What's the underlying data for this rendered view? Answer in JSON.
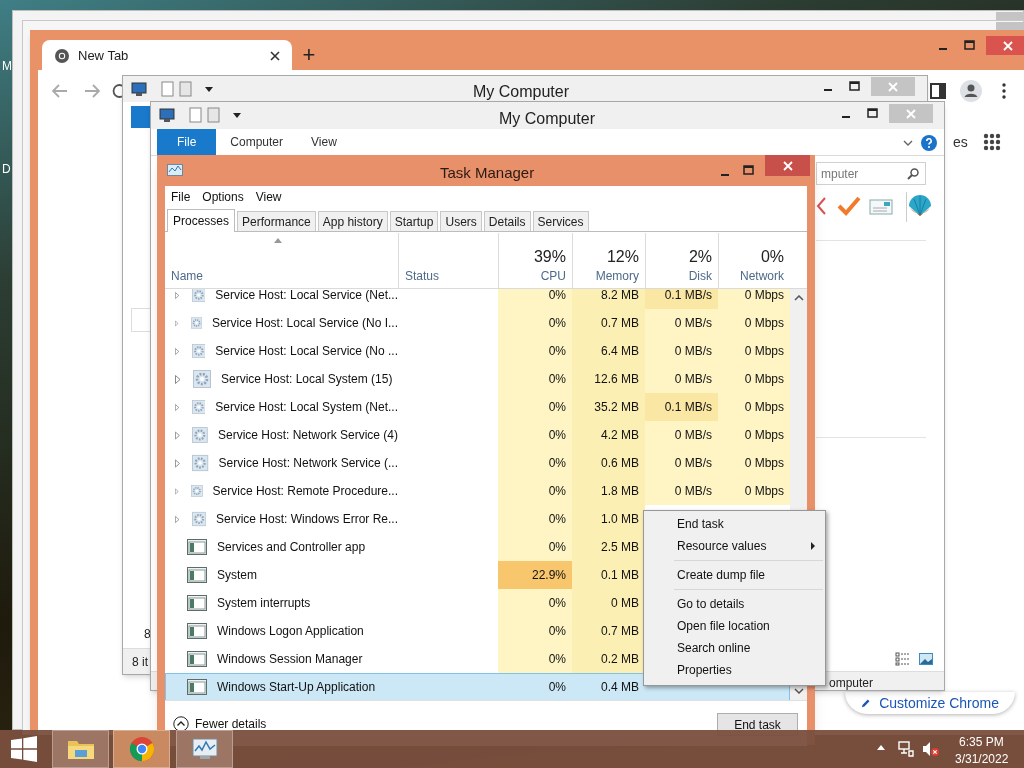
{
  "desktop_labels": [
    "M",
    "D"
  ],
  "browser": {
    "tab": {
      "title": "New Tab",
      "selected": true
    },
    "new_tab": "+",
    "partial_text": "es",
    "customize_button": "Customize Chrome"
  },
  "explorer_back": {
    "title": "My Computer",
    "row_partial": "8",
    "status_partial": "8 it"
  },
  "explorer_front": {
    "title": "My Computer",
    "ribbon_tabs": [
      {
        "label": "File",
        "selected": true
      },
      {
        "label": "Computer",
        "selected": false
      },
      {
        "label": "View",
        "selected": false
      }
    ],
    "search": {
      "placeholder": "mputer"
    },
    "status": "omputer"
  },
  "task_manager": {
    "title": "Task Manager",
    "menu": [
      "File",
      "Options",
      "View"
    ],
    "tabs": [
      {
        "label": "Processes",
        "selected": true
      },
      {
        "label": "Performance",
        "selected": false
      },
      {
        "label": "App history",
        "selected": false
      },
      {
        "label": "Startup",
        "selected": false
      },
      {
        "label": "Users",
        "selected": false
      },
      {
        "label": "Details",
        "selected": false
      },
      {
        "label": "Services",
        "selected": false
      }
    ],
    "columns": [
      {
        "label": "Name"
      },
      {
        "label": "Status"
      },
      {
        "label": "CPU",
        "total": "39%"
      },
      {
        "label": "Memory",
        "total": "12%"
      },
      {
        "label": "Disk",
        "total": "2%"
      },
      {
        "label": "Network",
        "total": "0%"
      }
    ],
    "rows": [
      {
        "kind": "service",
        "name": "Service Host: Local Service (Net...",
        "cpu": "0%",
        "memory": "8.2 MB",
        "disk": "0.1 MB/s",
        "network": "0 Mbps",
        "cpu_high": false,
        "disk_high": true,
        "selected": false
      },
      {
        "kind": "service",
        "name": "Service Host: Local Service (No I...",
        "cpu": "0%",
        "memory": "0.7 MB",
        "disk": "0 MB/s",
        "network": "0 Mbps",
        "cpu_high": false,
        "disk_high": false,
        "selected": false
      },
      {
        "kind": "service",
        "name": "Service Host: Local Service (No ...",
        "cpu": "0%",
        "memory": "6.4 MB",
        "disk": "0 MB/s",
        "network": "0 Mbps",
        "cpu_high": false,
        "disk_high": false,
        "selected": false
      },
      {
        "kind": "service",
        "name": "Service Host: Local System (15)",
        "cpu": "0%",
        "memory": "12.6 MB",
        "disk": "0 MB/s",
        "network": "0 Mbps",
        "cpu_high": false,
        "disk_high": false,
        "selected": false
      },
      {
        "kind": "service",
        "name": "Service Host: Local System (Net...",
        "cpu": "0%",
        "memory": "35.2 MB",
        "disk": "0.1 MB/s",
        "network": "0 Mbps",
        "cpu_high": false,
        "disk_high": true,
        "selected": false
      },
      {
        "kind": "service",
        "name": "Service Host: Network Service (4)",
        "cpu": "0%",
        "memory": "4.2 MB",
        "disk": "0 MB/s",
        "network": "0 Mbps",
        "cpu_high": false,
        "disk_high": false,
        "selected": false
      },
      {
        "kind": "service",
        "name": "Service Host: Network Service (...",
        "cpu": "0%",
        "memory": "0.6 MB",
        "disk": "0 MB/s",
        "network": "0 Mbps",
        "cpu_high": false,
        "disk_high": false,
        "selected": false
      },
      {
        "kind": "service",
        "name": "Service Host: Remote Procedure...",
        "cpu": "0%",
        "memory": "1.8 MB",
        "disk": "0 MB/s",
        "network": "0 Mbps",
        "cpu_high": false,
        "disk_high": false,
        "selected": false
      },
      {
        "kind": "service",
        "name": "Service Host: Windows Error Re...",
        "cpu": "0%",
        "memory": "1.0 MB",
        "cpu_high": false,
        "selected": false
      },
      {
        "kind": "app",
        "name": "Services and Controller app",
        "cpu": "0%",
        "memory": "2.5 MB",
        "cpu_high": false,
        "selected": false
      },
      {
        "kind": "app",
        "name": "System",
        "cpu": "22.9%",
        "memory": "0.1 MB",
        "cpu_high": true,
        "selected": false
      },
      {
        "kind": "app",
        "name": "System interrupts",
        "cpu": "0%",
        "memory": "0 MB",
        "cpu_high": false,
        "selected": false
      },
      {
        "kind": "app",
        "name": "Windows Logon Application",
        "cpu": "0%",
        "memory": "0.7 MB",
        "cpu_high": false,
        "selected": false
      },
      {
        "kind": "app",
        "name": "Windows Session Manager",
        "cpu": "0%",
        "memory": "0.2 MB",
        "cpu_high": false,
        "selected": false
      },
      {
        "kind": "app",
        "name": "Windows Start-Up Application",
        "cpu": "0%",
        "memory": "0.4 MB",
        "cpu_high": false,
        "selected": true
      }
    ],
    "fewer_details": "Fewer details",
    "end_task": "End task"
  },
  "context_menu": [
    {
      "kind": "item",
      "label": "End task"
    },
    {
      "kind": "submenu",
      "label": "Resource values"
    },
    {
      "kind": "separator"
    },
    {
      "kind": "item",
      "label": "Create dump file"
    },
    {
      "kind": "separator"
    },
    {
      "kind": "item",
      "label": "Go to details"
    },
    {
      "kind": "item",
      "label": "Open file location"
    },
    {
      "kind": "item",
      "label": "Search online"
    },
    {
      "kind": "item",
      "label": "Properties"
    }
  ],
  "taskbar": {
    "apps": [
      {
        "kind": "explorer"
      },
      {
        "kind": "chrome"
      },
      {
        "kind": "taskmgr"
      }
    ],
    "time": "6:35 PM",
    "date": "3/31/2022"
  }
}
